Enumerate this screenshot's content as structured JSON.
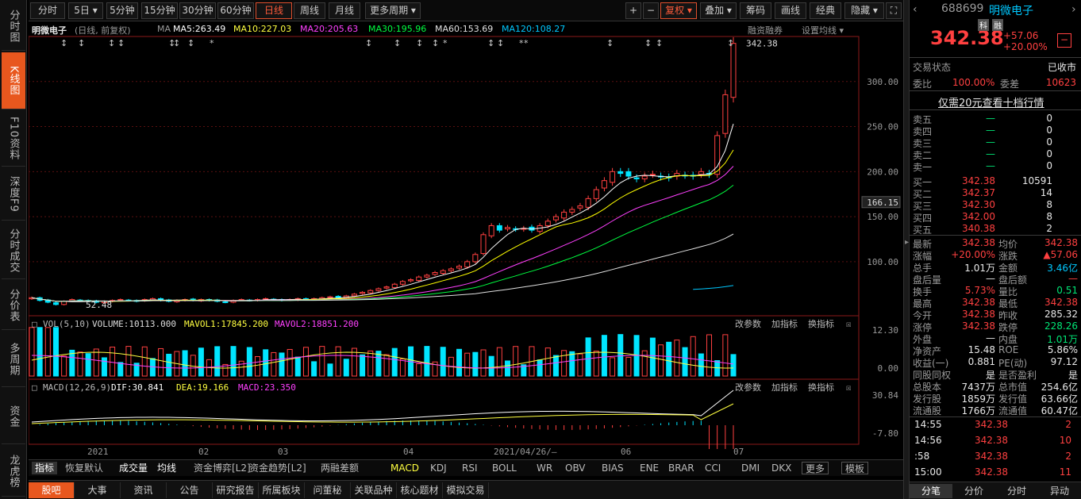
{
  "sidebar": [
    "分时图",
    "K线图",
    "F10资料",
    "深度F9",
    "分时成交",
    "分价表",
    "多周期",
    "资金",
    "龙虎榜"
  ],
  "toolbar": {
    "periods": [
      "分时",
      "5日",
      "5分钟",
      "15分钟",
      "30分钟",
      "60分钟",
      "日线",
      "周线",
      "月线",
      "更多周期"
    ],
    "right": [
      "复权",
      "叠加",
      "筹码",
      "画线",
      "经典",
      "隐藏"
    ],
    "plus": "+",
    "minus": "−"
  },
  "legend": {
    "name": "明微电子",
    "mode": "(日线, 前复权)",
    "ma": "MA",
    "ma5": "MA5:263.49",
    "ma10": "MA10:227.03",
    "ma20": "MA20:205.63",
    "ma30": "MA30:195.96",
    "ma60": "MA60:153.69",
    "ma120": "MA120:108.27",
    "margin": "融资融券",
    "settings": "设置均线"
  },
  "vol_legend": {
    "title": "VOL(5,10)",
    "volume": "VOLUME:10113.000",
    "mavol1": "MAVOL1:17845.200",
    "mavol2": "MAVOL2:18851.200",
    "p1": "改参数",
    "p2": "加指标",
    "p3": "换指标"
  },
  "macd_legend": {
    "title": "MACD(12,26,9)",
    "dif": "DIF:30.841",
    "dea": "DEA:19.166",
    "macd": "MACD:23.350"
  },
  "colors": {
    "ma5": "#ffffff",
    "ma10": "#ffff00",
    "ma20": "#ff40ff",
    "ma30": "#00ff40",
    "ma60": "#e0e0e0",
    "ma120": "#00c8ff",
    "up": "#ff4040",
    "down": "#00e5ff"
  },
  "price_axis": [
    "300.00",
    "250.00",
    "200.00",
    "150.00",
    "100.00"
  ],
  "price_marker": "166.15",
  "last_label": "342.38",
  "low_label": "52.48",
  "vol_axis": [
    "12.30",
    "0.00"
  ],
  "macd_axis": [
    "30.84",
    "-7.80"
  ],
  "x_axis": [
    "2021",
    "02",
    "03",
    "04",
    "2021/04/26/—",
    "06",
    "07"
  ],
  "chart_data": {
    "type": "candlestick",
    "ylim": [
      40,
      350
    ],
    "last": 342.38,
    "close_series": [
      60,
      57,
      55,
      52.48,
      56,
      58,
      57,
      56,
      55,
      56,
      57,
      58,
      57,
      56,
      58,
      59,
      57,
      56,
      57,
      58,
      57,
      58,
      57,
      56,
      55,
      57,
      58,
      57,
      58,
      59,
      58,
      57,
      58,
      59,
      58,
      59,
      60,
      61,
      60,
      62,
      64,
      66,
      68,
      70,
      72,
      75,
      78,
      80,
      83,
      85,
      88,
      90,
      92,
      95,
      100,
      108,
      130,
      140,
      135,
      138,
      136,
      137,
      135,
      140,
      145,
      150,
      155,
      158,
      162,
      170,
      180,
      190,
      200,
      198,
      195,
      192,
      195,
      197,
      194,
      193,
      198,
      196,
      195,
      200,
      197,
      240,
      285.32,
      342.38
    ]
  },
  "indicator_tabs": [
    "指标",
    "恢复默认",
    "成交量",
    "均线",
    "资金博弈[L2]",
    "资金趋势[L2]",
    "两融差额",
    "MACD",
    "KDJ",
    "RSI",
    "BOLL",
    "WR",
    "OBV",
    "BIAS",
    "ENE",
    "BRAR",
    "CCI",
    "DMI",
    "DKX",
    "更多",
    "模板"
  ],
  "bottom_tabs": [
    "股吧",
    "大事",
    "资讯",
    "公告",
    "研究报告",
    "所属板块",
    "问董秘",
    "关联品种",
    "核心题材",
    "模拟交易"
  ],
  "stock": {
    "code": "688699",
    "name": "明微电子",
    "badge1": "科",
    "badge2": "融",
    "price": "342.38",
    "change": "+57.06",
    "pct": "+20.00%"
  },
  "status": {
    "label": "交易状态",
    "value": "已收市",
    "wb_label": "委比",
    "wb": "100.00%",
    "wc_label": "委差",
    "wc": "10623"
  },
  "level_link": "仅需20元查看十档行情",
  "asks": [
    {
      "l": "卖五",
      "p": "—",
      "v": "0"
    },
    {
      "l": "卖四",
      "p": "—",
      "v": "0"
    },
    {
      "l": "卖三",
      "p": "—",
      "v": "0"
    },
    {
      "l": "卖二",
      "p": "—",
      "v": "0"
    },
    {
      "l": "卖一",
      "p": "—",
      "v": "0"
    }
  ],
  "bids": [
    {
      "l": "买一",
      "p": "342.38",
      "v": "10591"
    },
    {
      "l": "买二",
      "p": "342.37",
      "v": "14"
    },
    {
      "l": "买三",
      "p": "342.30",
      "v": "8"
    },
    {
      "l": "买四",
      "p": "342.00",
      "v": "8"
    },
    {
      "l": "买五",
      "p": "340.38",
      "v": "2"
    }
  ],
  "stats": [
    [
      "最新",
      "342.38",
      "均价",
      "342.38"
    ],
    [
      "涨幅",
      "+20.00%",
      "涨跌",
      "▲57.06"
    ],
    [
      "总手",
      "1.01万",
      "金额",
      "3.46亿"
    ],
    [
      "盘后量",
      "—",
      "盘后额",
      "—"
    ],
    [
      "换手",
      "5.73%",
      "量比",
      "0.51"
    ],
    [
      "最高",
      "342.38",
      "最低",
      "342.38"
    ],
    [
      "今开",
      "342.38",
      "昨收",
      "285.32"
    ],
    [
      "涨停",
      "342.38",
      "跌停",
      "228.26"
    ],
    [
      "外盘",
      "—",
      "内盘",
      "1.01万"
    ],
    [
      "净资产",
      "15.48",
      "ROE",
      "5.86%"
    ],
    [
      "收益(一)",
      "0.881",
      "PE(动)",
      "97.12"
    ],
    [
      "同股同权",
      "是",
      "是否盈利",
      "是"
    ],
    [
      "总股本",
      "7437万",
      "总市值",
      "254.6亿"
    ],
    [
      "发行股",
      "1859万",
      "发行值",
      "63.66亿"
    ],
    [
      "流通股",
      "1766万",
      "流通值",
      "60.47亿"
    ]
  ],
  "ticks": [
    [
      "14:55",
      "342.38",
      "2"
    ],
    [
      "14:56",
      "342.38",
      "10"
    ],
    [
      ":58",
      "342.38",
      "2"
    ],
    [
      "15:00",
      "342.38",
      "11"
    ]
  ],
  "right_tabs": [
    "分笔",
    "分价",
    "分时",
    "异动"
  ]
}
